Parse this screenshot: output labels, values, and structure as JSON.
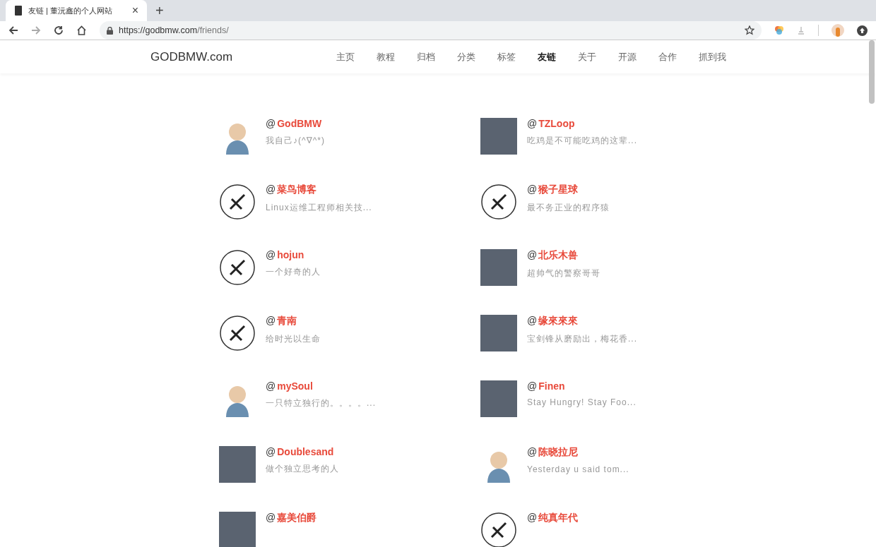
{
  "browser": {
    "tab_title": "友链 | 董沅鑫的个人网站",
    "new_tab": "+",
    "close_tab": "×",
    "url": "https://godbmw.com/friends/"
  },
  "site": {
    "logo": "GODBMW.com",
    "nav": [
      {
        "label": "主页",
        "selected": false
      },
      {
        "label": "教程",
        "selected": false
      },
      {
        "label": "归档",
        "selected": false
      },
      {
        "label": "分类",
        "selected": false
      },
      {
        "label": "标签",
        "selected": false
      },
      {
        "label": "友链",
        "selected": true
      },
      {
        "label": "关于",
        "selected": false
      },
      {
        "label": "开源",
        "selected": false
      },
      {
        "label": "合作",
        "selected": false
      },
      {
        "label": "抓到我",
        "selected": false
      }
    ]
  },
  "friends": [
    {
      "at": "@",
      "name": "GodBMW",
      "description": "我自己♪(^∇^*)",
      "kind": "drawing"
    },
    {
      "at": "@",
      "name": "TZLoop",
      "description": "吃鸡是不可能吃鸡的这辈...",
      "kind": "photo"
    },
    {
      "at": "@",
      "name": "菜鸟博客",
      "description": "Linux运维工程师相关技...",
      "kind": "logo"
    },
    {
      "at": "@",
      "name": "猴子星球",
      "description": "最不务正业的程序猿",
      "kind": "logo"
    },
    {
      "at": "@",
      "name": "hojun",
      "description": "一个好奇的人",
      "kind": "logo"
    },
    {
      "at": "@",
      "name": "北乐木兽",
      "description": "超帅气的警察哥哥",
      "kind": "photo"
    },
    {
      "at": "@",
      "name": "青南",
      "description": "给时光以生命",
      "kind": "logo"
    },
    {
      "at": "@",
      "name": "缘來來來",
      "description": "宝剑锋从磨励出，梅花香...",
      "kind": "photo"
    },
    {
      "at": "@",
      "name": "mySoul",
      "description": "一只特立独行的。。。。...",
      "kind": "drawing"
    },
    {
      "at": "@",
      "name": "Finen",
      "description": "Stay Hungry! Stay Foo...",
      "kind": "photo"
    },
    {
      "at": "@",
      "name": "Doublesand",
      "description": "做个独立思考的人",
      "kind": "photo"
    },
    {
      "at": "@",
      "name": "陈晓拉尼",
      "description": "Yesterday u said tom...",
      "kind": "drawing"
    },
    {
      "at": "@",
      "name": "嘉美伯爵",
      "kind": "photo"
    },
    {
      "at": "@",
      "name": "纯真年代",
      "kind": "logo"
    }
  ]
}
